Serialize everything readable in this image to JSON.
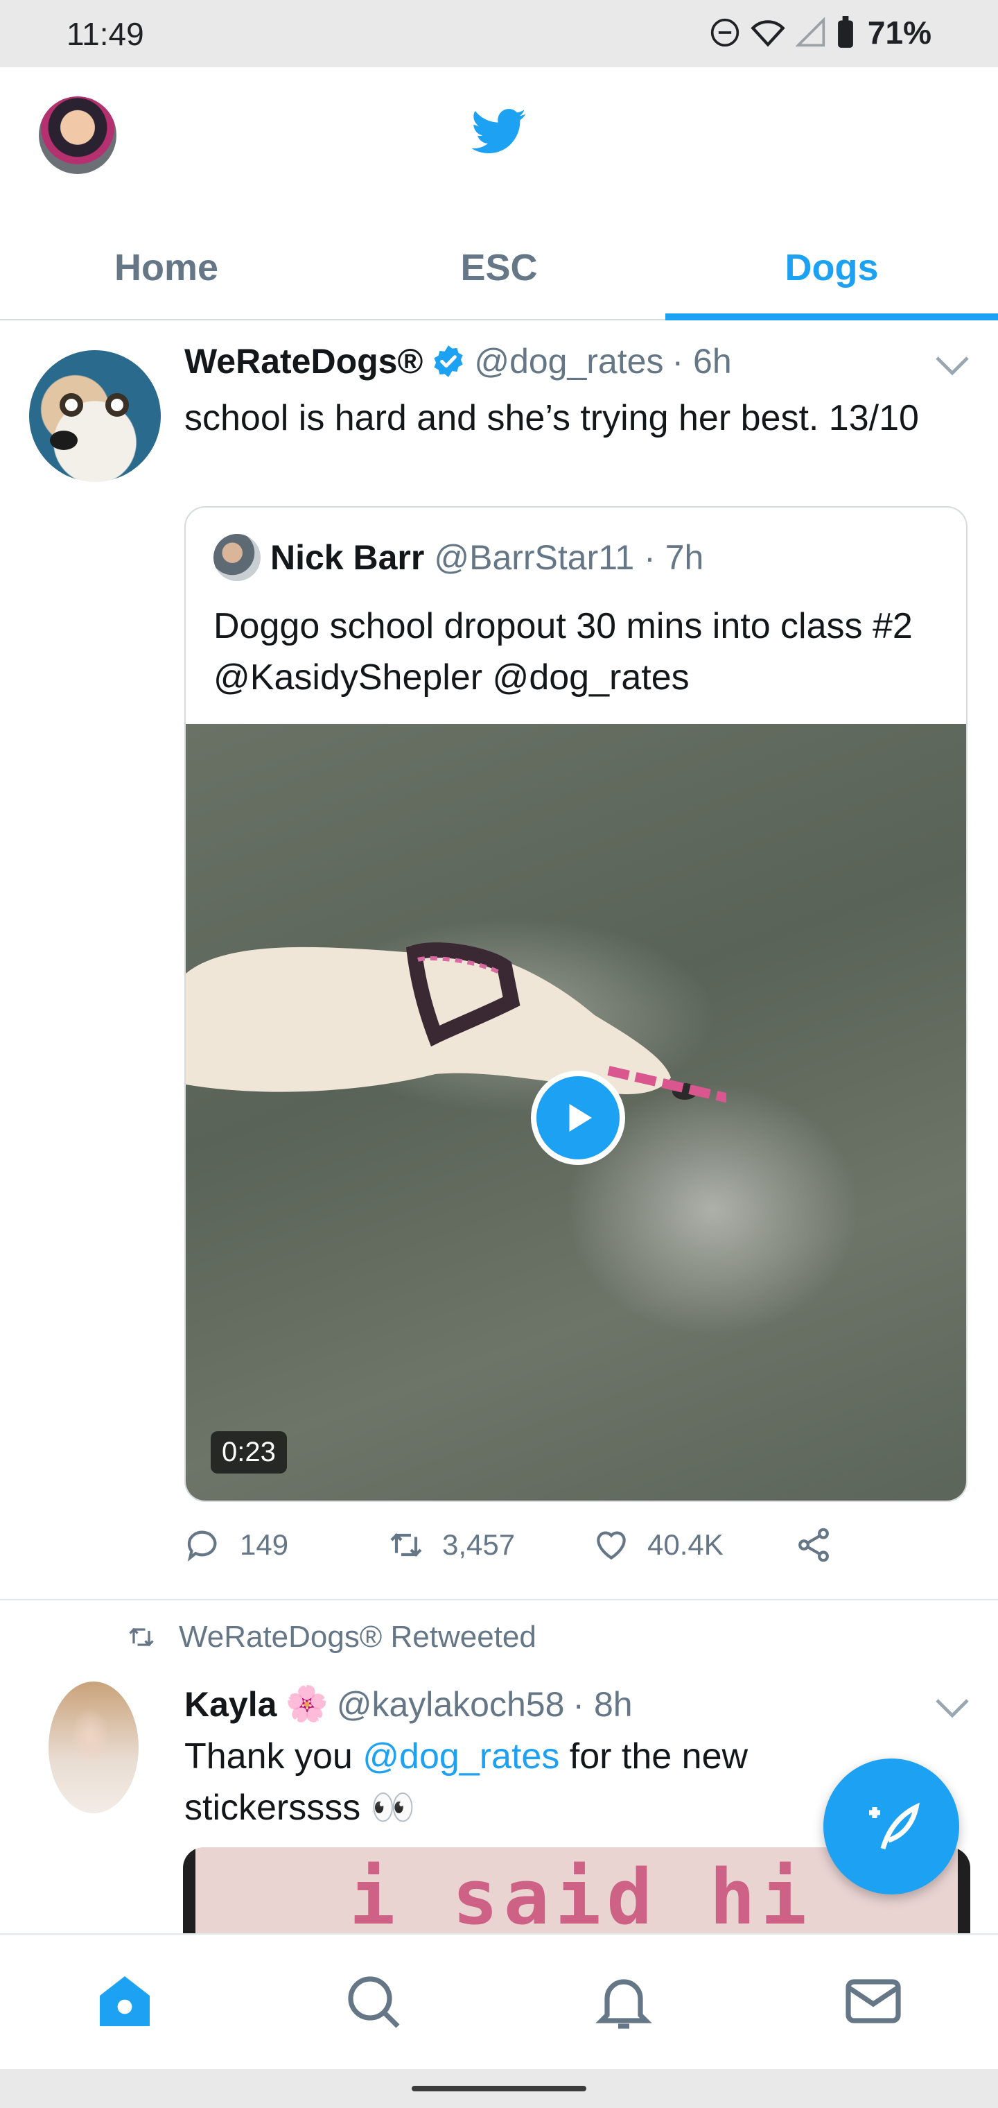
{
  "status_bar": {
    "time": "11:49",
    "battery": "71%"
  },
  "tabs": [
    {
      "label": "Home",
      "active": false
    },
    {
      "label": "ESC",
      "active": false
    },
    {
      "label": "Dogs",
      "active": true
    }
  ],
  "tweet": {
    "name": "WeRateDogs®",
    "handle": "@dog_rates",
    "time": "· 6h",
    "text": "school is hard and she’s trying her best. 13/10",
    "quote": {
      "name": "Nick Barr",
      "handle": "@BarrStar11",
      "time": "· 7h",
      "text": "Doggo school dropout 30 mins into class #2 @KasidyShepler @dog_rates",
      "duration": "0:23"
    },
    "actions": {
      "replies": "149",
      "retweets": "3,457",
      "likes": "40.4K"
    }
  },
  "retweet": {
    "banner": "WeRateDogs® Retweeted",
    "name": "Kayla",
    "emoji": "🌸",
    "handle": "@kaylakoch58",
    "time": "· 8h",
    "text_before": "Thank you ",
    "mention": "@dog_rates",
    "text_after": " for the new stickerssss 👀",
    "media_text": "i said hi"
  },
  "colors": {
    "accent": "#1da1f2",
    "muted": "#657786",
    "text": "#14171a"
  },
  "icons": [
    "twitter-bird-icon",
    "verified-badge-icon",
    "chevron-down-icon",
    "play-icon",
    "reply-icon",
    "retweet-icon",
    "like-icon",
    "share-icon",
    "compose-icon",
    "home-icon",
    "search-icon",
    "notifications-icon",
    "messages-icon"
  ]
}
